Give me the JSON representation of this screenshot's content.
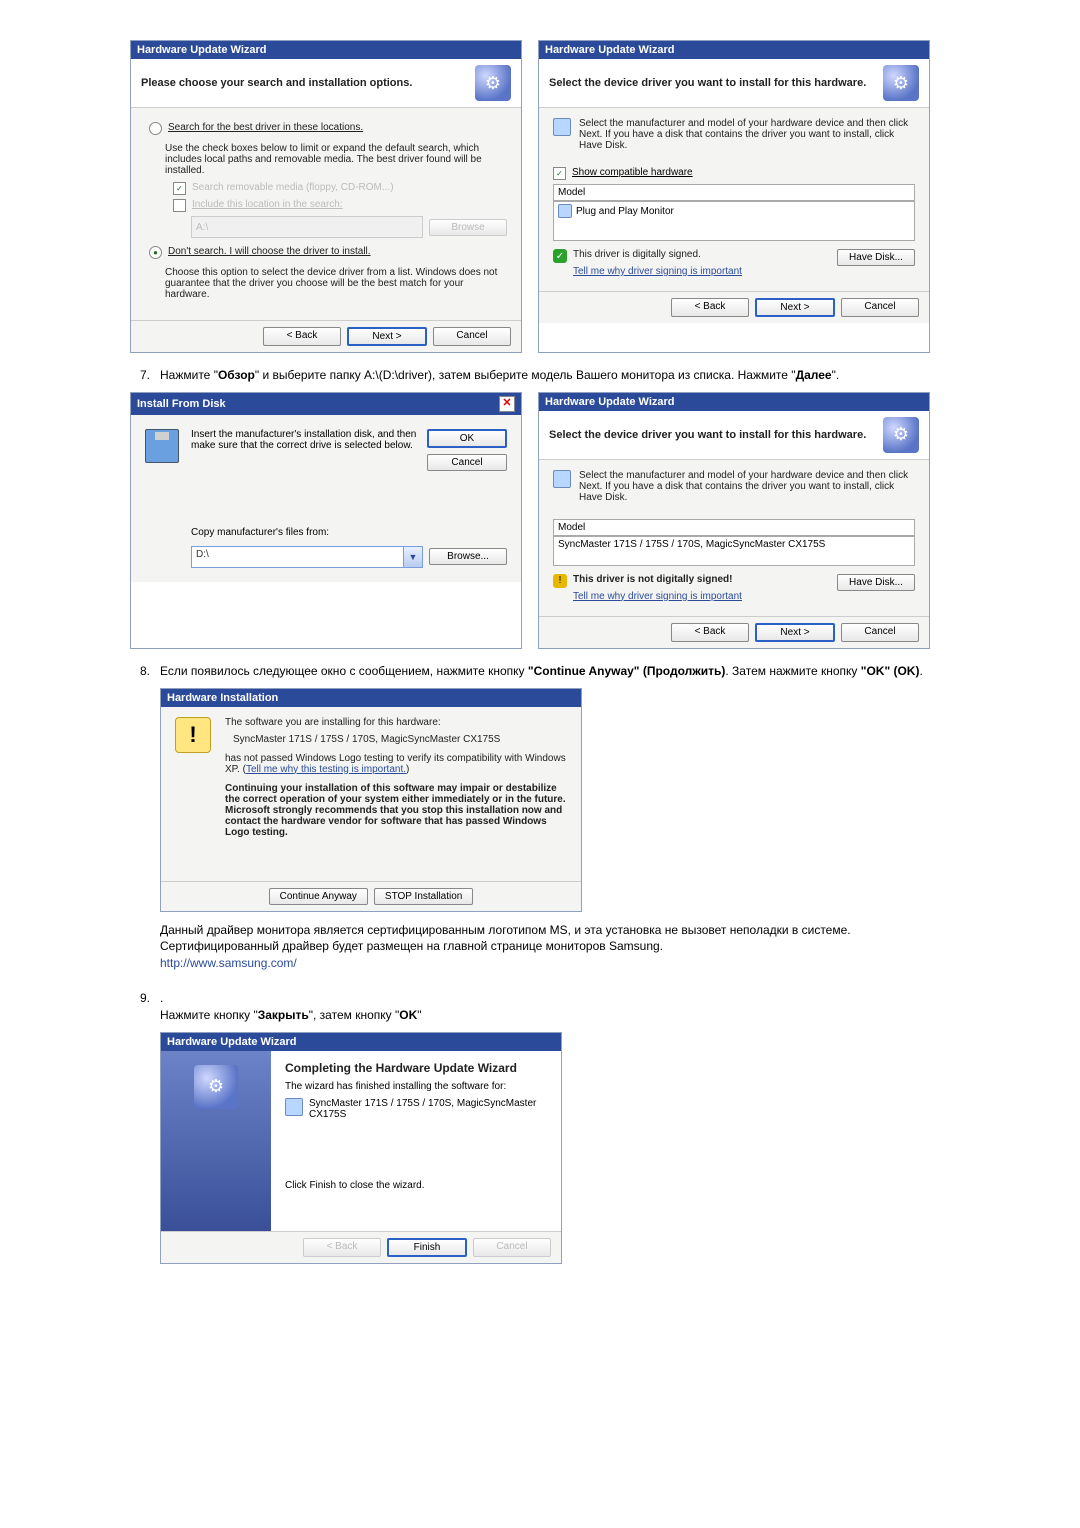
{
  "win1": {
    "title": "Hardware Update Wizard",
    "banner": "Please choose your search and installation options.",
    "radio_search": "Search for the best driver in these locations.",
    "search_help": "Use the check boxes below to limit or expand the default search, which includes local paths and removable media. The best driver found will be installed.",
    "check_removable": "Search removable media (floppy, CD-ROM...)",
    "check_include": "Include this location in the search:",
    "path": "A:\\",
    "browse": "Browse",
    "radio_dont_search": "Don't search. I will choose the driver to install.",
    "dont_search_help": "Choose this option to select the device driver from a list. Windows does not guarantee that the driver you choose will be the best match for your hardware.",
    "back": "< Back",
    "next": "Next >",
    "cancel": "Cancel"
  },
  "win2": {
    "title": "Hardware Update Wizard",
    "banner": "Select the device driver you want to install for this hardware.",
    "instruction": "Select the manufacturer and model of your hardware device and then click Next. If you have a disk that contains the driver you want to install, click Have Disk.",
    "show_compat": "Show compatible hardware",
    "model_header": "Model",
    "model_item": "Plug and Play Monitor",
    "signed": "This driver is digitally signed.",
    "tell_me": "Tell me why driver signing is important",
    "have_disk": "Have Disk...",
    "back": "< Back",
    "next": "Next >",
    "cancel": "Cancel"
  },
  "step7_pre": "Нажмите \"",
  "step7_b1": "Обзор",
  "step7_mid": "\" и выберите папку A:\\(D:\\driver), затем выберите модель Вашего монитора из списка. Нажмите \"",
  "step7_b2": "Далее",
  "step7_end": "\".",
  "ifd": {
    "title": "Install From Disk",
    "instruction": "Insert the manufacturer's installation disk, and then make sure that the correct drive is selected below.",
    "ok": "OK",
    "cancel": "Cancel",
    "copy_from": "Copy manufacturer's files from:",
    "path": "D:\\",
    "browse": "Browse..."
  },
  "win4": {
    "title": "Hardware Update Wizard",
    "banner": "Select the device driver you want to install for this hardware.",
    "instruction": "Select the manufacturer and model of your hardware device and then click Next. If you have a disk that contains the driver you want to install, click Have Disk.",
    "model_header": "Model",
    "model_item": "SyncMaster 171S / 175S / 170S,  MagicSyncMaster CX175S",
    "not_signed": "This driver is not digitally signed!",
    "tell_me": "Tell me why driver signing is important",
    "have_disk": "Have Disk...",
    "back": "< Back",
    "next": "Next >",
    "cancel": "Cancel"
  },
  "step8_pre": "Если появилось следующее окно с сообщением, нажмите кнопку ",
  "step8_b1": "\"Continue Anyway\" (Продолжить)",
  "step8_mid": ". Затем нажмите кнопку ",
  "step8_b2": "\"OK\" (OK)",
  "step8_end": ".",
  "hwi": {
    "title": "Hardware Installation",
    "line1": "The software you are installing for this hardware:",
    "device": "SyncMaster 171S / 175S / 170S,  MagicSyncMaster CX175S",
    "line2": "has not passed Windows Logo testing to verify its compatibility with Windows XP. (",
    "link": "Tell me why this testing is important.",
    "line2_end": ")",
    "warn": "Continuing your installation of this software may impair or destabilize the correct operation of your system either immediately or in the future. Microsoft strongly recommends that you stop this installation now and contact the hardware vendor for software that has passed Windows Logo testing.",
    "continue": "Continue Anyway",
    "stop": "STOP Installation"
  },
  "note_text": "Данный драйвер монитора является сертифицированным логотипом MS, и эта установка не вызовет неполадки в системе. Сертифицированный драйвер будет размещен на главной странице мониторов Samsung.",
  "sam_link": "http://www.samsung.com/",
  "step9_dot": ".",
  "step9_pre": "Нажмите кнопку \"",
  "step9_b1": "Закрыть",
  "step9_mid": "\", затем кнопку \"",
  "step9_b2": "OK",
  "step9_end": "\"",
  "win_done": {
    "title": "Hardware Update Wizard",
    "heading": "Completing the Hardware Update Wizard",
    "line1": "The wizard has finished installing the software for:",
    "device": "SyncMaster 171S / 175S / 170S,  MagicSyncMaster CX175S",
    "line2": "Click Finish to close the wizard.",
    "back": "< Back",
    "finish": "Finish",
    "cancel": "Cancel"
  }
}
